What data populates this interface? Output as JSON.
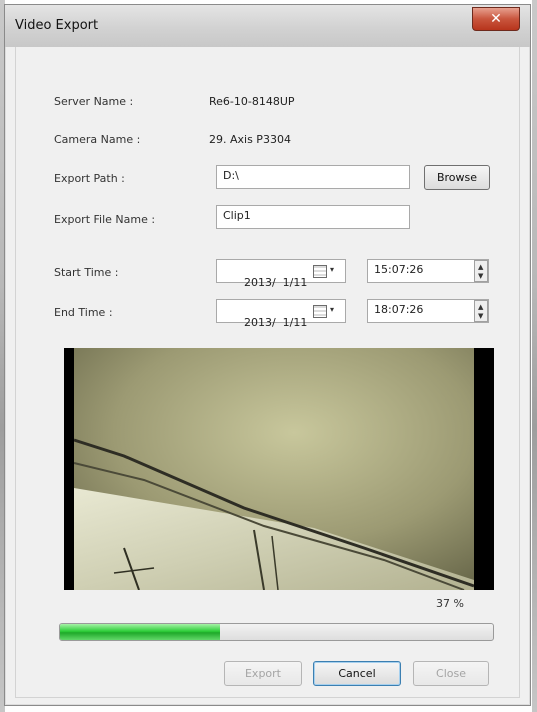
{
  "window": {
    "title": "Video Export",
    "close_glyph": "✕"
  },
  "form": {
    "server_name_label": "Server Name :",
    "server_name_value": "Re6-10-8148UP",
    "camera_name_label": "Camera Name :",
    "camera_name_value": "29. Axis P3304",
    "export_path_label": "Export Path :",
    "export_path_value": "D:\\",
    "browse_label": "Browse",
    "export_file_name_label": "Export File Name :",
    "export_file_name_value": "Clip1",
    "start_time_label": "Start Time :",
    "start_date": "2013/  1/11",
    "start_time": "15:07:26",
    "end_time_label": "End Time :",
    "end_date": "2013/  1/11",
    "end_time": "18:07:26"
  },
  "progress": {
    "percent_text": "37 %",
    "fraction": 0.37
  },
  "buttons": {
    "export": "Export",
    "cancel": "Cancel",
    "close": "Close"
  },
  "icons": {
    "calendar": "calendar-icon",
    "dropdown": "▾",
    "spin_up": "▲",
    "spin_down": "▼"
  }
}
